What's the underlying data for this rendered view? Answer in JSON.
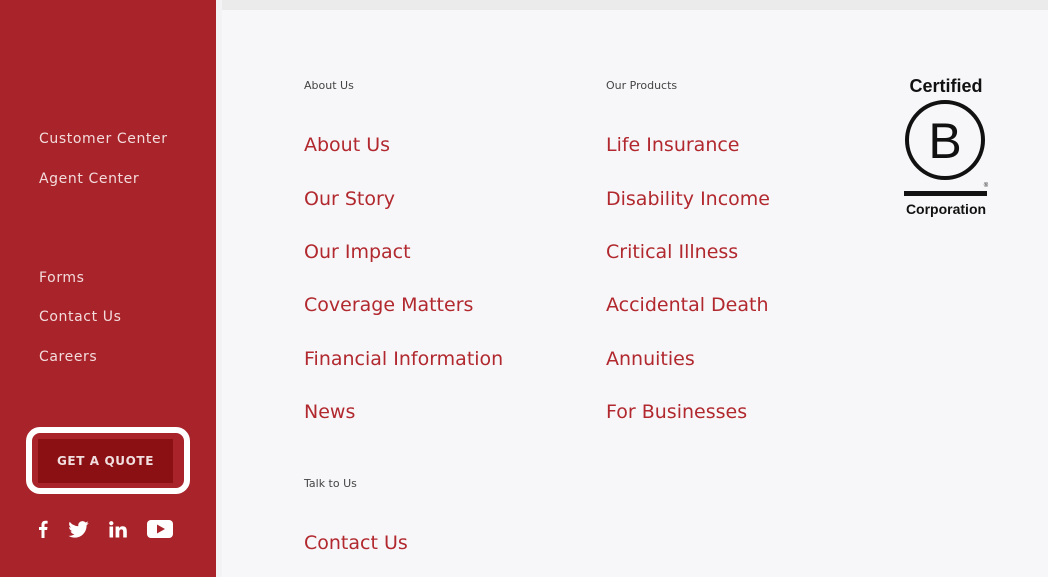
{
  "sidebar": {
    "primary_links": [
      "Customer Center",
      "Agent Center"
    ],
    "secondary_links": [
      "Forms",
      "Contact Us",
      "Careers"
    ],
    "cta_label": "GET A QUOTE",
    "social": [
      {
        "name": "facebook-icon",
        "label": "f"
      },
      {
        "name": "twitter-icon",
        "label": "twitter"
      },
      {
        "name": "linkedin-icon",
        "label": "in"
      },
      {
        "name": "youtube-icon",
        "label": "youtube"
      }
    ]
  },
  "columns": {
    "about": {
      "heading": "About Us",
      "links": [
        "About Us",
        "Our Story",
        "Our Impact",
        "Coverage Matters",
        "Financial Information",
        "News"
      ]
    },
    "products": {
      "heading": "Our Products",
      "links": [
        "Life Insurance",
        "Disability Income",
        "Critical Illness",
        "Accidental Death",
        "Annuities",
        "For Businesses"
      ]
    },
    "talk": {
      "heading": "Talk to Us",
      "links": [
        "Contact Us"
      ]
    }
  },
  "badge": {
    "top_text": "Certified",
    "letter": "B",
    "bottom_text": "Corporation",
    "registered_mark": "®"
  },
  "colors": {
    "sidebar_bg": "#a8232a",
    "button_bg": "#8a1014",
    "link_red": "#b1282e",
    "page_bg": "#f7f7f9"
  }
}
